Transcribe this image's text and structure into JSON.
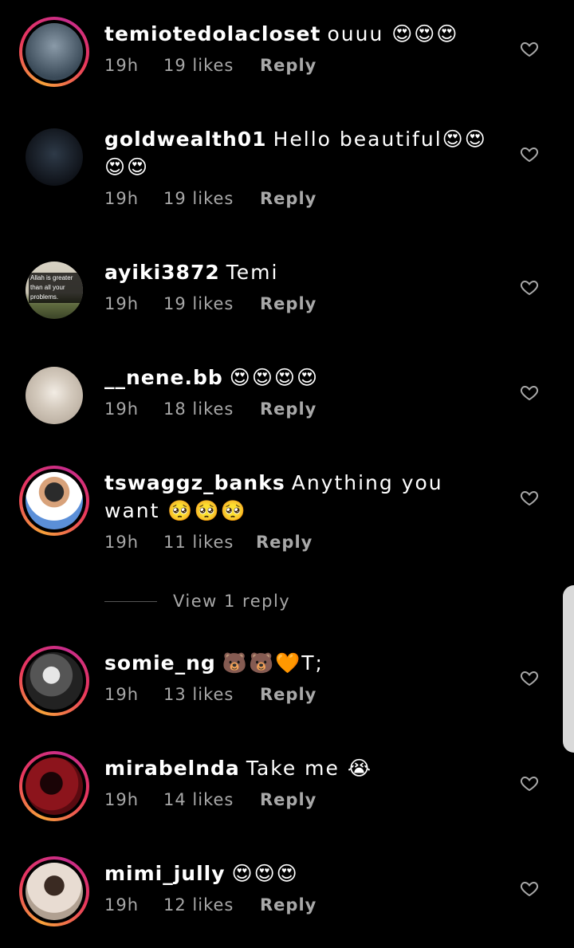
{
  "comments": [
    {
      "username": "temiotedolacloset",
      "text": "ouuu 😍😍😍",
      "time": "19h",
      "likes": "19 likes",
      "reply": "Reply",
      "avatar_color": "#4a5a68",
      "ring": true
    },
    {
      "username": "goldwealth01",
      "text": "Hello beautiful😍😍😍😍",
      "time": "19h",
      "likes": "19 likes",
      "reply": "Reply",
      "avatar_color": "#1e2a36",
      "ring": false
    },
    {
      "username": "ayiki3872",
      "text": "Temi",
      "time": "19h",
      "likes": "19 likes",
      "reply": "Reply",
      "avatar_color": "#6b7350",
      "ring": false,
      "avatar_text": "Allah is greater than all your problems."
    },
    {
      "username": "__nene.bb",
      "text": "😍😍😍😍",
      "time": "19h",
      "likes": "18 likes",
      "reply": "Reply",
      "avatar_color": "#c9bfb3",
      "ring": false
    },
    {
      "username": "tswaggz_banks",
      "text": "Anything you want 🥺🥺🥺",
      "time": "19h",
      "likes": "11 likes",
      "reply": "Reply",
      "avatar_color": "#e8edf2",
      "ring": true
    },
    {
      "username": "somie_ng",
      "text": "🐻🐻🧡T;",
      "time": "19h",
      "likes": "13 likes",
      "reply": "Reply",
      "avatar_color": "#777777",
      "ring": true
    },
    {
      "username": "mirabelnda",
      "text": "Take me 😭",
      "time": "19h",
      "likes": "14 likes",
      "reply": "Reply",
      "avatar_color": "#7a1218",
      "ring": true
    },
    {
      "username": "mimi_jully",
      "text": "😍😍😍",
      "time": "19h",
      "likes": "12 likes",
      "reply": "Reply",
      "avatar_color": "#b9a79a",
      "ring": true
    }
  ],
  "view_replies": "View 1 reply",
  "colors": {
    "background": "#000000",
    "meta_text": "#a8a8a8",
    "ring_start": "#f7a13a",
    "ring_end": "#c72c8c"
  }
}
